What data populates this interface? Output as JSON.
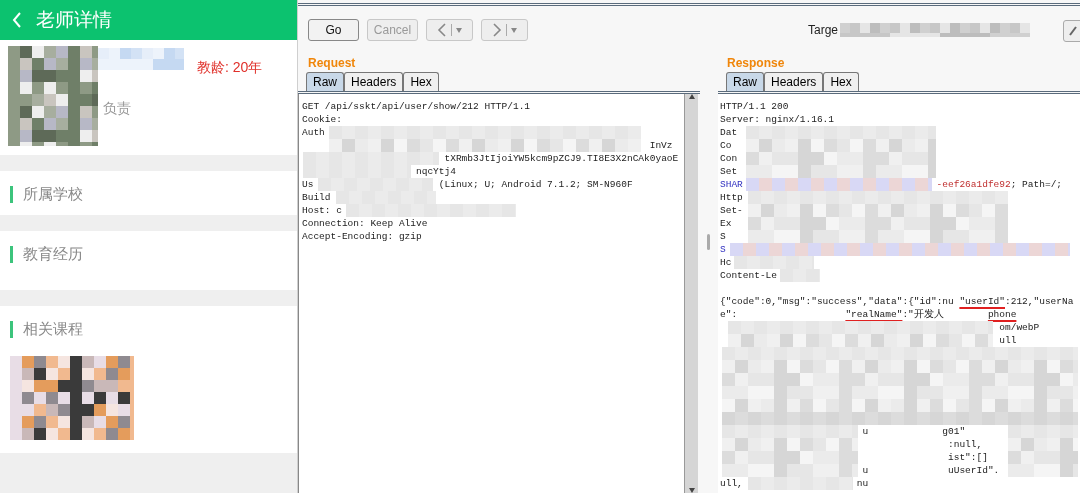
{
  "app": {
    "title": "老师详情",
    "teaching_years": "教龄: 20年",
    "role": "负责",
    "sections": [
      {
        "title": "所属学校",
        "kind": "plain"
      },
      {
        "title": "教育经历",
        "kind": "plain"
      },
      {
        "title": "相关课程",
        "kind": "courses"
      }
    ]
  },
  "repeater": {
    "toolbar": [
      {
        "kind": "text",
        "label": "Go",
        "disabled": false
      },
      {
        "kind": "text",
        "label": "Cancel",
        "disabled": true
      },
      {
        "kind": "back",
        "disabled": true
      },
      {
        "kind": "forward",
        "disabled": true
      }
    ],
    "target_label": "Targe",
    "request": {
      "title": "Request",
      "tabs": [
        {
          "label": "Raw",
          "selected": true
        },
        {
          "label": "Headers",
          "selected": false
        },
        {
          "label": "Hex",
          "selected": false
        }
      ],
      "lines": [
        {
          "start": [
            {
              "text": "GET /api/sskt/api/user/show/212 HTTP/1.1"
            }
          ]
        },
        {
          "start": [
            {
              "text": "Cookie:"
            }
          ]
        },
        {
          "start": [
            {
              "text": "Auth"
            }
          ]
        },
        {
          "mid": [
            {
              "text": "InVz"
            }
          ]
        },
        {
          "mid": [
            {
              "text": "tXRmb3JtIjoiYW5kcm9pZCJ9.TI8E3X2nCAk0yaoE"
            }
          ]
        },
        {
          "mid": [
            {
              "text": "nqcYtj4"
            }
          ]
        },
        {
          "start": [
            {
              "text": "Us"
            }
          ],
          "mid": [
            {
              "text": "(Linux; U; Android 7.1.2; SM-N960F"
            }
          ]
        },
        {
          "start": [
            {
              "text": "Build"
            }
          ]
        },
        {
          "start": [
            {
              "text": "Host: c"
            }
          ]
        },
        {
          "start": [
            {
              "text": "Connection: Keep Alive"
            }
          ]
        },
        {
          "start": [
            {
              "text": "Accept-Encoding: gzip"
            }
          ]
        }
      ]
    },
    "response": {
      "title": "Response",
      "tabs": [
        {
          "label": "Raw",
          "selected": true
        },
        {
          "label": "Headers",
          "selected": false
        },
        {
          "label": "Hex",
          "selected": false
        }
      ],
      "header_lines": [
        {
          "start": [
            {
              "text": "HTTP/1.1 200"
            }
          ]
        },
        {
          "start": [
            {
              "text": "Server: nginx/1.16.1"
            }
          ]
        },
        {
          "start": [
            {
              "text": "Dat"
            }
          ]
        },
        {
          "start": [
            {
              "text": "Co"
            }
          ]
        },
        {
          "start": [
            {
              "text": "Con"
            }
          ]
        },
        {
          "start": [
            {
              "text": "Set"
            }
          ]
        },
        {
          "start": [
            {
              "text": "SHAR",
              "kind": "name"
            }
          ],
          "mid": [
            {
              "text": "-eef26a1dfe92",
              "kind": "value"
            },
            {
              "text": "; Path=/;"
            }
          ]
        },
        {
          "start": [
            {
              "text": "Http"
            }
          ]
        },
        {
          "start": [
            {
              "text": "Set-"
            }
          ]
        },
        {
          "start": [
            {
              "text": "Ex"
            }
          ]
        },
        {
          "start": [
            {
              "text": "S"
            }
          ]
        },
        {
          "start": [
            {
              "text": "S",
              "kind": "name"
            }
          ]
        },
        {
          "start": [
            {
              "text": "Hc"
            }
          ]
        },
        {
          "start": [
            {
              "text": "Content-Le"
            }
          ]
        }
      ],
      "body_top": [
        {
          "start": [
            {
              "text": "{\"code\":0,\"msg\":\"success\",\"data\":{\"id\":nu"
            }
          ],
          "mid": [
            {
              "text": "\"userId\"",
              "underlined": true
            },
            {
              "text": ":212,\"userNa"
            }
          ]
        },
        {
          "start": [
            {
              "text": "e\":"
            }
          ],
          "mid": [
            {
              "text": "\"realName\"",
              "underlined": true
            },
            {
              "text": ":\"开发人"
            }
          ],
          "end": [
            {
              "text": "phone",
              "underlined": true
            }
          ]
        },
        {
          "mid": [
            {
              "text": "om/webP"
            }
          ]
        },
        {
          "mid": [
            {
              "text": "ull"
            }
          ]
        }
      ],
      "body_bottom": [
        {
          "mid": [
            {
              "text": "u"
            }
          ],
          "end": [
            {
              "text": "g01\""
            }
          ]
        },
        {
          "end": [
            {
              "text": ":null,"
            }
          ]
        },
        {
          "end": [
            {
              "text": "ist\":[]"
            }
          ]
        },
        {
          "mid": [
            {
              "text": "u"
            }
          ],
          "end": [
            {
              "text": "uUserId\"."
            }
          ]
        },
        {
          "start": [
            {
              "text": "ull,"
            }
          ],
          "mid": [
            {
              "text": "nu"
            }
          ]
        }
      ]
    }
  }
}
